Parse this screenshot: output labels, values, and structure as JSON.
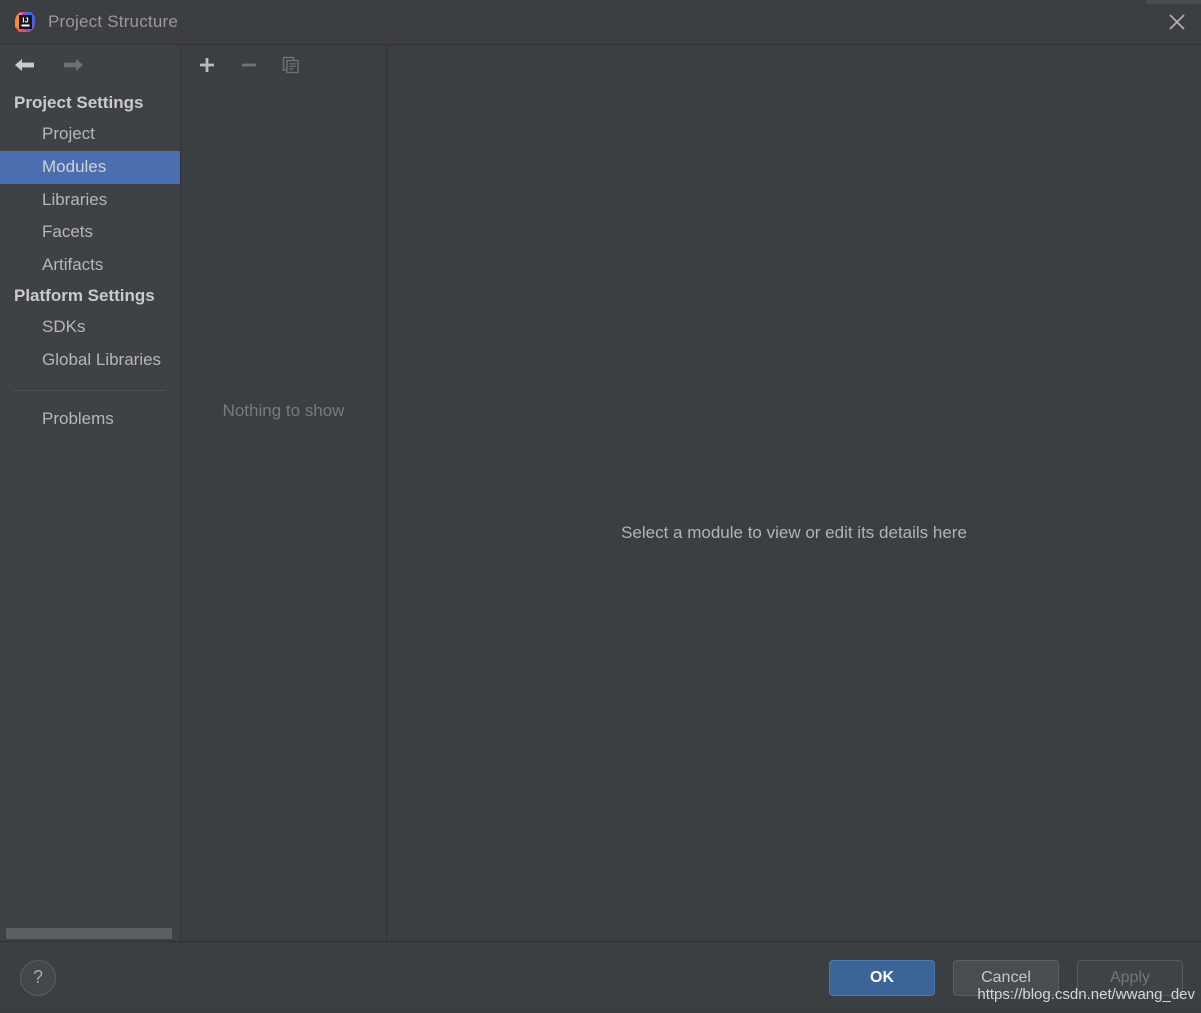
{
  "window": {
    "title": "Project Structure",
    "logo_icon": "intellij-idea-logo",
    "close_icon": "close-icon"
  },
  "sidebar": {
    "nav": {
      "back_icon": "arrow-left-icon",
      "forward_icon": "arrow-right-icon"
    },
    "groups": [
      {
        "label": "Project Settings",
        "items": [
          {
            "label": "Project",
            "selected": false
          },
          {
            "label": "Modules",
            "selected": true
          },
          {
            "label": "Libraries",
            "selected": false
          },
          {
            "label": "Facets",
            "selected": false
          },
          {
            "label": "Artifacts",
            "selected": false
          }
        ]
      },
      {
        "label": "Platform Settings",
        "items": [
          {
            "label": "SDKs",
            "selected": false
          },
          {
            "label": "Global Libraries",
            "selected": false
          }
        ]
      }
    ],
    "extra_items": [
      {
        "label": "Problems",
        "selected": false
      }
    ]
  },
  "middle_panel": {
    "toolbar": [
      {
        "name": "add-button",
        "icon": "plus-icon",
        "enabled": true
      },
      {
        "name": "remove-button",
        "icon": "minus-icon",
        "enabled": false
      },
      {
        "name": "copy-button",
        "icon": "copy-icon",
        "enabled": false
      }
    ],
    "empty_text": "Nothing to show"
  },
  "detail_panel": {
    "message": "Select a module to view or edit its details here"
  },
  "footer": {
    "help_label": "?",
    "help_icon": "question-mark-icon",
    "buttons": {
      "ok": "OK",
      "cancel": "Cancel",
      "apply": "Apply"
    }
  },
  "watermark": {
    "text": "https://blog.csdn.net/wwang_dev"
  },
  "colors": {
    "dialog_background": "#3c3f41",
    "sidebar_background": "#3f4244",
    "selection_blue": "#4b6eaf",
    "ok_button_blue": "#3c6497",
    "primary_text": "#b4b7b9",
    "muted_text": "#767a7d"
  }
}
